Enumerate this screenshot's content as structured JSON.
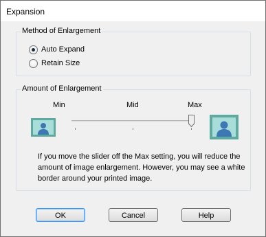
{
  "window": {
    "title": "Expansion"
  },
  "method_group": {
    "legend": "Method of Enlargement",
    "options": [
      {
        "label": "Auto Expand",
        "checked": true
      },
      {
        "label": "Retain Size",
        "checked": false
      }
    ]
  },
  "amount_group": {
    "legend": "Amount of Enlargement",
    "slider": {
      "labels": {
        "min": "Min",
        "mid": "Mid",
        "max": "Max"
      },
      "value_fraction": 1.0
    },
    "icons": {
      "small": "person-small-icon",
      "large": "person-large-icon"
    },
    "description": "If you move the slider off the Max setting, you will reduce the amount of image enlargement. However, you may see a white border around your printed image."
  },
  "buttons": {
    "ok": "OK",
    "cancel": "Cancel",
    "help": "Help"
  },
  "colors": {
    "accent": "#3399ff",
    "icon_frame": "#5eaa9f",
    "icon_fill": "#a9ddda",
    "person": "#3d78b4"
  }
}
